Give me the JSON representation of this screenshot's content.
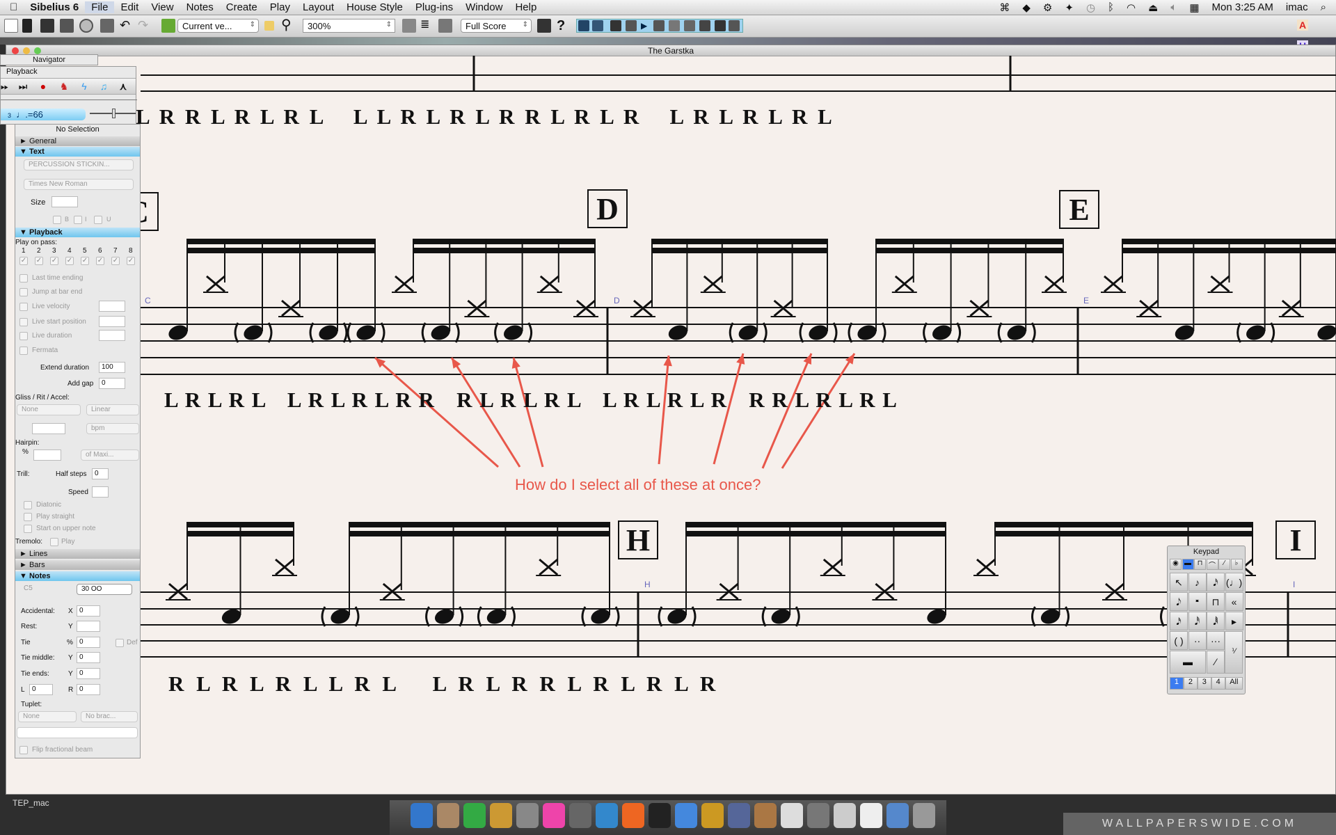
{
  "menubar": {
    "app": "Sibelius 6",
    "items": [
      "File",
      "Edit",
      "View",
      "Notes",
      "Create",
      "Play",
      "Layout",
      "House Style",
      "Plug-ins",
      "Window",
      "Help"
    ],
    "clock": "Mon 3:25 AM",
    "user": "imac"
  },
  "toolbar": {
    "version_select": "Current ve...",
    "zoom": "300%",
    "part_select": "Full Score",
    "help": "?"
  },
  "window": {
    "title": "The Garstka"
  },
  "navigator": {
    "title": "Navigator"
  },
  "playback": {
    "title": "Playback",
    "tempo_bar": "3",
    "tempo": "♩.=66"
  },
  "properties": {
    "title": "No Selection",
    "sections": {
      "general": "General",
      "text": "Text",
      "playback": "Playback",
      "lines": "Lines",
      "bars": "Bars",
      "notes": "Notes"
    },
    "text": {
      "style": "PERCUSSION STICKIN...",
      "font": "Times New Roman",
      "size_label": "Size",
      "bold": "B",
      "italic": "I",
      "underline": "U"
    },
    "pb": {
      "play_on_pass": "Play on pass:",
      "passes": [
        "1",
        "2",
        "3",
        "4",
        "5",
        "6",
        "7",
        "8"
      ],
      "last_time": "Last time ending",
      "jump": "Jump at bar end",
      "live_velocity": "Live velocity",
      "live_start": "Live start position",
      "live_duration": "Live duration",
      "fermata": "Fermata",
      "extend_label": "Extend duration",
      "extend_value": "100",
      "gap_label": "Add gap",
      "gap_value": "0",
      "gliss_label": "Gliss / Rit / Accel:",
      "gliss_type": "None",
      "gliss_curve": "Linear",
      "bpm": "bpm",
      "hairpin_label": "Hairpin:",
      "percent": "%",
      "hairpin_of": "of Maxi...",
      "trill_label": "Trill:",
      "half_steps_label": "Half steps",
      "half_steps_value": "0",
      "speed_label": "Speed",
      "diatonic": "Diatonic",
      "play_straight": "Play straight",
      "start_upper": "Start on upper note",
      "tremolo_label": "Tremolo:",
      "tremolo_play": "Play"
    },
    "notes": {
      "pitch": "C5",
      "notehead": "30  OO",
      "accidental": "Accidental:",
      "rest": "Rest:",
      "tie": "Tie",
      "tie_middle": "Tie middle:",
      "tie_ends": "Tie ends:",
      "x": "X",
      "y": "Y",
      "pct": "%",
      "l": "L",
      "r": "R",
      "zero": "0",
      "def": "Def",
      "tuplet": "Tuplet:",
      "tuplet_none": "None",
      "bracket": "No brac...",
      "flip": "Flip fractional beam"
    }
  },
  "score": {
    "rehearsal_marks": [
      "C",
      "D",
      "E",
      "H",
      "I"
    ],
    "staff_labels": [
      "C",
      "D",
      "E",
      "H",
      "I"
    ],
    "sticking": [
      "L R R L R L R L   L L R L R L R R L R L R   L R L R L R L",
      "L R L R L   L R L R L R R   R L R L R L   L R L R L R   R R L R L R L",
      "R L R L R L L R L   L R L R R L R L R L R"
    ],
    "staff2_groups": [
      [
        "n",
        "xh",
        "g",
        "xm",
        "g",
        "g"
      ],
      [
        "xh",
        "g",
        "xm",
        "g",
        "xh",
        "xm"
      ],
      [
        "xm",
        "n",
        "xh",
        "g",
        "xm",
        "g"
      ],
      [
        "g",
        "xh",
        "g",
        "xm",
        "g",
        "xh"
      ],
      [
        "xh",
        "xm",
        "n",
        "xh",
        "g",
        "xm",
        "n"
      ]
    ],
    "staff3_groups": [
      [
        "xm",
        "n",
        "xh"
      ],
      [
        "g",
        "xm",
        "g",
        "g",
        "xh",
        "g"
      ],
      [
        "g",
        "xm",
        "g",
        "xh",
        "xm",
        "n"
      ],
      [
        "xh",
        "g",
        "xm",
        "g",
        "xh"
      ]
    ]
  },
  "annotation": {
    "text": "How do I select all of these at once?",
    "color": "#e8574a"
  },
  "keypad": {
    "title": "Keypad",
    "layouts": [
      "1",
      "2",
      "3",
      "4",
      "All"
    ]
  },
  "desktop": {
    "label": "TEP_mac",
    "watermark": "WALLPAPERSWIDE.COM"
  },
  "colors": {
    "accent": "#6fc6ee",
    "paper": "#f6f0ec"
  }
}
